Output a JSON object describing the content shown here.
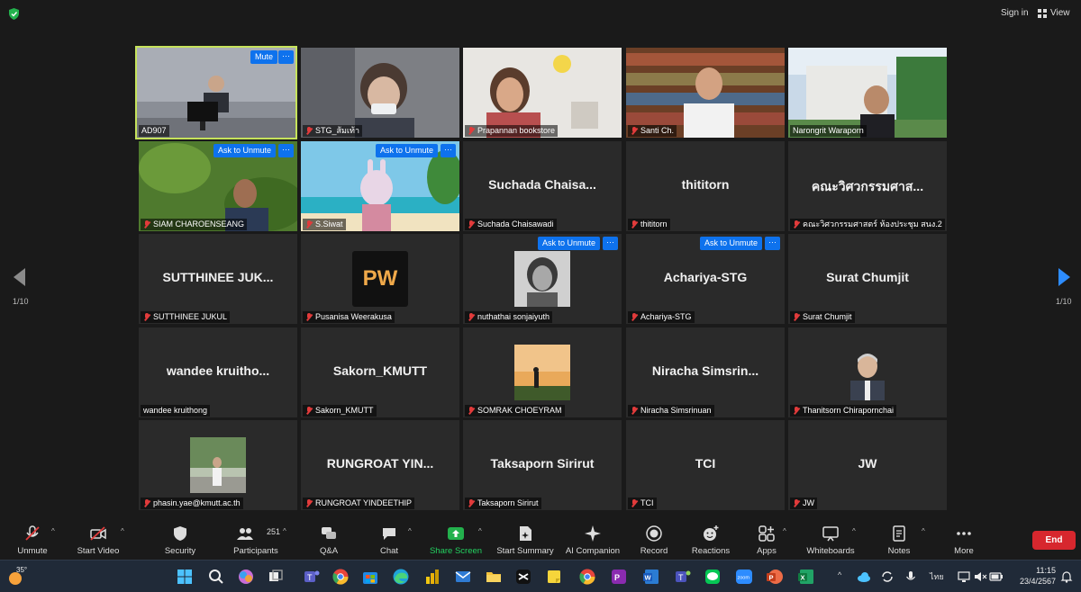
{
  "topbar": {
    "signin": "Sign in",
    "view": "View"
  },
  "controls": {
    "mute": "Mute",
    "ask_to_unmute": "Ask to Unmute",
    "more": "···"
  },
  "tiles": [
    {
      "name": "AD907",
      "big": ""
    },
    {
      "name": "STG_ส้มเท้า",
      "big": ""
    },
    {
      "name": "Prapannan bookstore",
      "big": ""
    },
    {
      "name": "Santi Ch.",
      "big": ""
    },
    {
      "name": "Narongrit Waraporn",
      "big": ""
    },
    {
      "name": "SIAM CHAROENSEANG",
      "big": ""
    },
    {
      "name": "S.Siwat",
      "big": ""
    },
    {
      "name": "Suchada Chaisawadi",
      "big": "Suchada Chaisa..."
    },
    {
      "name": "thititorn",
      "big": "thititorn"
    },
    {
      "name": "คณะวิศวกรรมศาสตร์ ห้องประชุม สนง.2",
      "big": "คณะวิศวกรรมศาส..."
    },
    {
      "name": "SUTTHINEE JUKUL",
      "big": "SUTTHINEE JUK..."
    },
    {
      "name": "Pusanisa Weerakusa",
      "big": "",
      "logo": "PW"
    },
    {
      "name": "nuthathai sonjaiyuth",
      "big": ""
    },
    {
      "name": "Achariya-STG",
      "big": "Achariya-STG"
    },
    {
      "name": "Surat Chumjit",
      "big": "Surat Chumjit"
    },
    {
      "name": "wandee kruithong",
      "big": "wandee kruitho..."
    },
    {
      "name": "Sakorn_KMUTT",
      "big": "Sakorn_KMUTT"
    },
    {
      "name": "SOMRAK CHOEYRAM",
      "big": ""
    },
    {
      "name": "Niracha Simsrinuan",
      "big": "Niracha Simsrin..."
    },
    {
      "name": "Thanitsorn Chirapornchai",
      "big": ""
    },
    {
      "name": "phasin.yae@kmutt.ac.th",
      "big": ""
    },
    {
      "name": "RUNGROAT YINDEETHIP",
      "big": "RUNGROAT YIN..."
    },
    {
      "name": "Taksaporn Sirirut",
      "big": "Taksaporn Sirirut"
    },
    {
      "name": "TCI",
      "big": "TCI"
    },
    {
      "name": "JW",
      "big": "JW"
    }
  ],
  "pagination": {
    "left": "1/10",
    "right": "1/10"
  },
  "toolbar": {
    "unmute": "Unmute",
    "start_video": "Start Video",
    "security": "Security",
    "participants": "Participants",
    "participants_count": "251",
    "qa": "Q&A",
    "chat": "Chat",
    "share_screen": "Share Screen",
    "start_summary": "Start Summary",
    "ai_companion": "AI Companion",
    "record": "Record",
    "reactions": "Reactions",
    "apps": "Apps",
    "whiteboards": "Whiteboards",
    "notes": "Notes",
    "more": "More",
    "end": "End"
  },
  "taskbar": {
    "temperature": "35°",
    "language": "ไทย",
    "time": "11:15",
    "date": "23/4/2567"
  }
}
